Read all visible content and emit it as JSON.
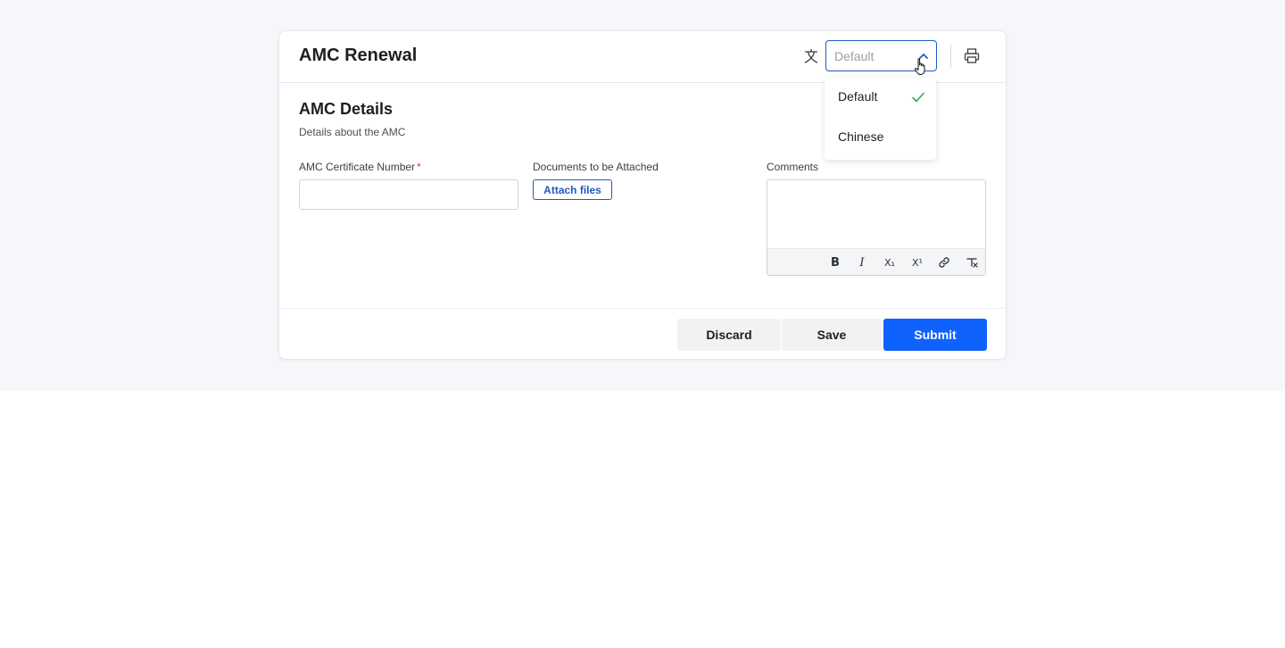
{
  "form": {
    "title": "AMC Renewal",
    "language": {
      "selected": "Default",
      "options": [
        {
          "label": "Default",
          "checked": true
        },
        {
          "label": "Chinese",
          "checked": false
        }
      ]
    }
  },
  "section": {
    "title": "AMC Details",
    "subtitle": "Details about the AMC"
  },
  "fields": {
    "certificate_label": "AMC Certificate Number",
    "required_mark": "*",
    "certificate_value": "",
    "documents_label": "Documents to be Attached",
    "attach_label": "Attach files",
    "comments_label": "Comments"
  },
  "toolbar": {
    "bold": "B",
    "italic": "I",
    "subscript": "X₁",
    "superscript": "X¹"
  },
  "actions": {
    "discard": "Discard",
    "save": "Save",
    "submit": "Submit"
  },
  "colors": {
    "accent": "#0f62fe",
    "select_border": "#1f5bbd",
    "required": "#e0352b",
    "check": "#3aa55d"
  }
}
